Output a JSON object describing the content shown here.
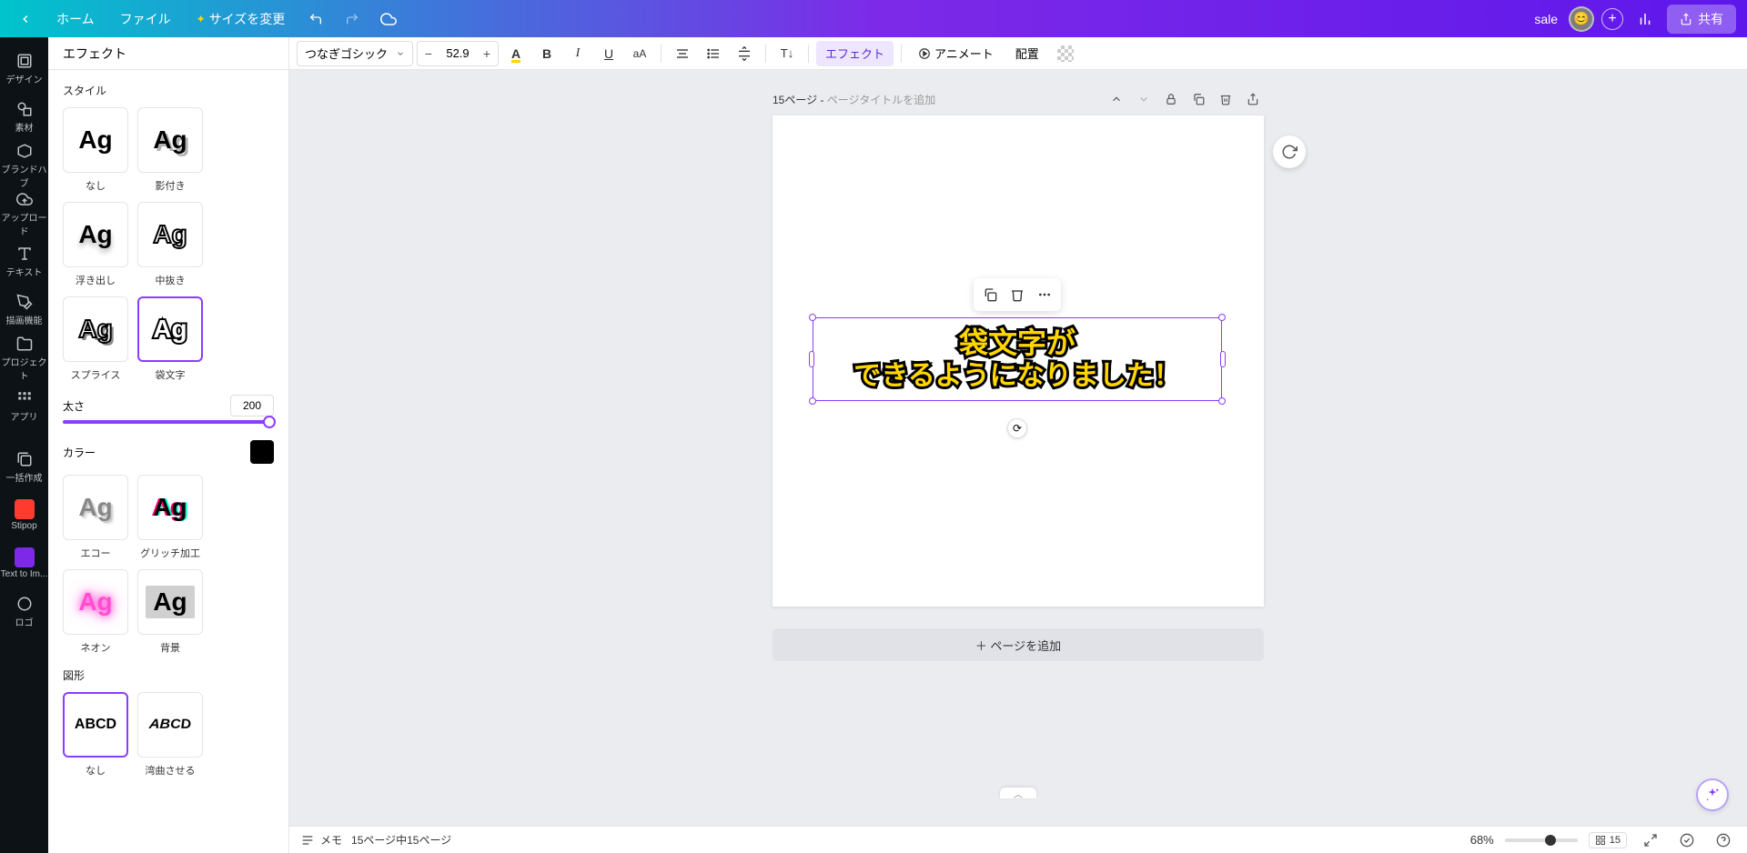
{
  "header": {
    "home": "ホーム",
    "file": "ファイル",
    "resize": "サイズを変更",
    "sale": "sale",
    "share": "共有"
  },
  "rail": {
    "design": "デザイン",
    "elements": "素材",
    "brandhub": "ブランドハブ",
    "upload": "アップロード",
    "text": "テキスト",
    "draw": "描画機能",
    "project": "プロジェクト",
    "apps": "アプリ",
    "bulk": "一括作成",
    "stipop": "Stipop",
    "tti": "Text to Im...",
    "logo": "ロゴ"
  },
  "panel": {
    "title": "エフェクト",
    "style_label": "スタイル",
    "styles": {
      "none": "なし",
      "shadow": "影付き",
      "lift": "浮き出し",
      "hollow": "中抜き",
      "splice": "スプライス",
      "outline": "袋文字",
      "echo": "エコー",
      "glitch": "グリッチ加工",
      "neon": "ネオン",
      "background": "背景"
    },
    "thickness_label": "太さ",
    "thickness_value": "200",
    "color_label": "カラー",
    "shape_label": "図形",
    "shapes": {
      "none": "なし",
      "curve": "湾曲させる"
    },
    "sample": "Ag",
    "shape_sample": "ABCD"
  },
  "toolbar": {
    "font": "つなぎゴシック",
    "size": "52.9",
    "effect": "エフェクト",
    "animate": "アニメート",
    "position": "配置"
  },
  "canvas": {
    "page_prefix": "15ページ - ",
    "page_title_placeholder": "ページタイトルを追加",
    "text_line1": "袋文字が",
    "text_line2": "できるようになりました！",
    "add_page": "＋ ページを追加"
  },
  "bottom": {
    "notes": "メモ",
    "page_counter": "15ページ中15ページ",
    "zoom": "68%",
    "page_num": "15"
  }
}
